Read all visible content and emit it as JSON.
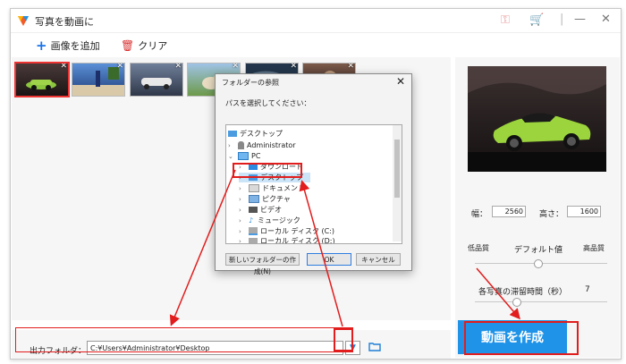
{
  "window": {
    "title": "写真を動画に",
    "minimize_glyph": "—",
    "close_glyph": "✕"
  },
  "toolbar": {
    "add_label": "画像を追加",
    "clear_label": "クリア"
  },
  "thumbnails": [
    {
      "name": "thumb-1",
      "selected": true
    },
    {
      "name": "thumb-2",
      "selected": false
    },
    {
      "name": "thumb-3",
      "selected": false
    },
    {
      "name": "thumb-4",
      "selected": false
    },
    {
      "name": "thumb-5",
      "selected": false
    },
    {
      "name": "thumb-6",
      "selected": false
    }
  ],
  "settings": {
    "width_label": "幅：",
    "width_value": "2560",
    "height_label": "高さ：",
    "height_value": "1600",
    "quality_low": "低品質",
    "quality_default": "デフォルト値",
    "quality_high": "高品質",
    "duration_label": "各写真の滞留時間（秒）",
    "duration_value": "7"
  },
  "output": {
    "label": "出力フォルダ：",
    "path": "C:¥Users¥Administrator¥Desktop"
  },
  "create_button": "動画を作成",
  "dialog": {
    "title": "フォルダーの参照",
    "close_glyph": "✕",
    "message": "パスを選択してください：",
    "tree": [
      {
        "label": "デスクトップ",
        "chev": ""
      },
      {
        "label": "Administrator",
        "chev": "›"
      },
      {
        "label": "PC",
        "chev": "⌄"
      },
      {
        "label": "ダウンロード",
        "chev": "›"
      },
      {
        "label": "デスクトップ",
        "chev": "›"
      },
      {
        "label": "ドキュメント",
        "chev": "›"
      },
      {
        "label": "ピクチャ",
        "chev": "›"
      },
      {
        "label": "ビデオ",
        "chev": "›"
      },
      {
        "label": "ミュージック",
        "chev": "›"
      },
      {
        "label": "ローカル ディスク (C:)",
        "chev": "›"
      },
      {
        "label": "ローカル ディスク (D:)",
        "chev": "›"
      }
    ],
    "new_folder_button": "新しいフォルダーの作成(N)",
    "ok_button": "OK",
    "cancel_button": "キャンセル"
  },
  "colors": {
    "accent_blue": "#1e93e8",
    "annotation_red": "#e21d1d",
    "selection_blue": "#cce4f7"
  },
  "icons": [
    "app-logo-icon",
    "key-icon",
    "cart-icon",
    "plus-icon",
    "trash-icon",
    "chevron-down-icon",
    "folder-icon",
    "close-icon"
  ]
}
